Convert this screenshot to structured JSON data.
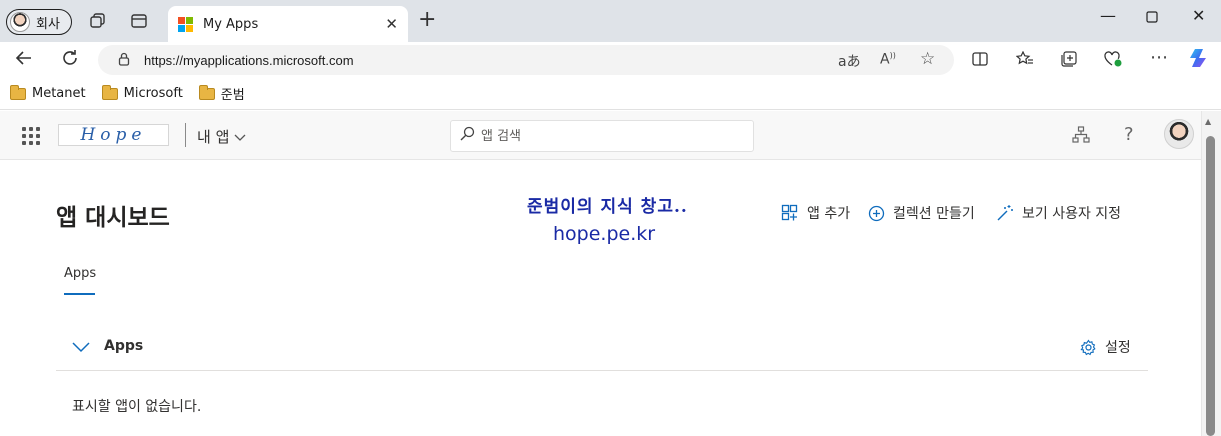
{
  "browser": {
    "profile_label": "회사",
    "tab_title": "My Apps",
    "url": "https://myapplications.microsoft.com",
    "favorites": [
      "Metanet",
      "Microsoft",
      "준범"
    ]
  },
  "header": {
    "brand_text": "Hope",
    "my_apps_label": "내 앱",
    "search_placeholder": "앱 검색"
  },
  "main": {
    "title": "앱 대시보드",
    "watermark_line1": "준범이의 지식 창고..",
    "watermark_line2": "hope.pe.kr",
    "actions": {
      "add_app": "앱 추가",
      "create_collection": "컬렉션 만들기",
      "customize_view": "보기 사용자 지정"
    },
    "tab_label": "Apps",
    "section_title": "Apps",
    "settings_label": "설정",
    "empty_message": "표시할 앱이 없습니다."
  },
  "colors": {
    "accent": "#0f6cbd",
    "titlebar_bg": "#dfe3e8",
    "header_bg": "#f8f8f8",
    "watermark": "#1a2aa5"
  },
  "icons": [
    "profile-avatar-icon",
    "workspaces-icon",
    "tab-actions-icon",
    "microsoft-logo-icon",
    "close-icon",
    "plus-icon",
    "minimize-icon",
    "maximize-icon",
    "back-icon",
    "refresh-icon",
    "lock-icon",
    "read-aloud-icon",
    "immersive-reader-icon",
    "star-icon",
    "split-screen-icon",
    "favorites-icon",
    "collections-icon",
    "browser-essentials-icon",
    "more-icon",
    "copilot-icon",
    "folder-icon",
    "app-launcher-icon",
    "search-icon",
    "chevron-down-icon",
    "org-chart-icon",
    "help-icon",
    "add-app-icon",
    "add-circle-icon",
    "magic-wand-icon",
    "chevron-icon",
    "gear-icon"
  ]
}
